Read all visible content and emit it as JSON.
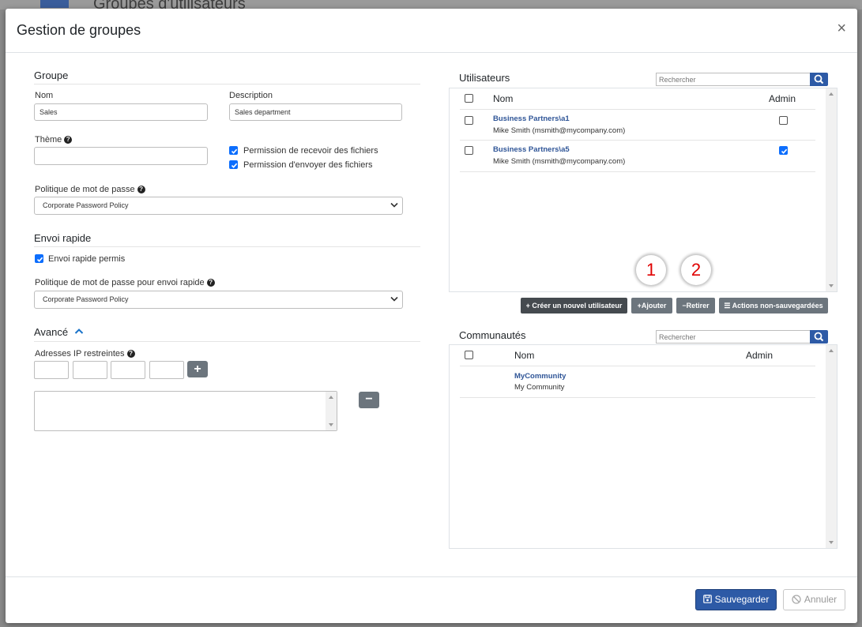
{
  "background": {
    "page_title": "Groupes d'utilisateurs"
  },
  "modal": {
    "title": "Gestion de groupes",
    "close_symbol": "×",
    "group": {
      "section_title": "Groupe",
      "name_label": "Nom",
      "name_value": "Sales",
      "description_label": "Description",
      "description_value": "Sales department",
      "theme_label": "Thème",
      "theme_value": "",
      "perm_receive_label": "Permission de recevoir des fichiers",
      "perm_receive_checked": true,
      "perm_send_label": "Permission d'envoyer des fichiers",
      "perm_send_checked": true,
      "password_policy_label": "Politique de mot de passe",
      "password_policy_value": "Corporate Password Policy"
    },
    "quick_send": {
      "section_title": "Envoi rapide",
      "allowed_label": "Envoi rapide permis",
      "allowed_checked": true,
      "password_policy_label": "Politique de mot de passe pour envoi rapide",
      "password_policy_value": "Corporate Password Policy"
    },
    "advanced": {
      "section_title": "Avancé",
      "restricted_ip_label": "Adresses IP restreintes",
      "add_symbol": "+",
      "remove_symbol": "−"
    },
    "users": {
      "title": "Utilisateurs",
      "search_placeholder": "Rechercher",
      "col_name": "Nom",
      "col_admin": "Admin",
      "rows": [
        {
          "name": "Business Partners\\a1",
          "email": "Mike Smith (msmith@mycompany.com)",
          "admin": false
        },
        {
          "name": "Business Partners\\a5",
          "email": "Mike Smith (msmith@mycompany.com)",
          "admin": true
        }
      ],
      "badges": [
        "1",
        "2"
      ],
      "actions": {
        "create": "Créer un nouvel utilisateur",
        "add": "Ajouter",
        "remove": "Retirer",
        "unsaved": "Actions non-sauvegardées"
      }
    },
    "communities": {
      "title": "Communautés",
      "search_placeholder": "Rechercher",
      "col_name": "Nom",
      "col_admin": "Admin",
      "rows": [
        {
          "name": "MyCommunity",
          "description": "My Community"
        }
      ]
    },
    "footer": {
      "save_label": "Sauvegarder",
      "cancel_label": "Annuler"
    }
  },
  "colors": {
    "primary": "#2d5aa6",
    "link": "#2f5597",
    "checkbox": "#0d6efd",
    "badge_text": "#e00000"
  }
}
